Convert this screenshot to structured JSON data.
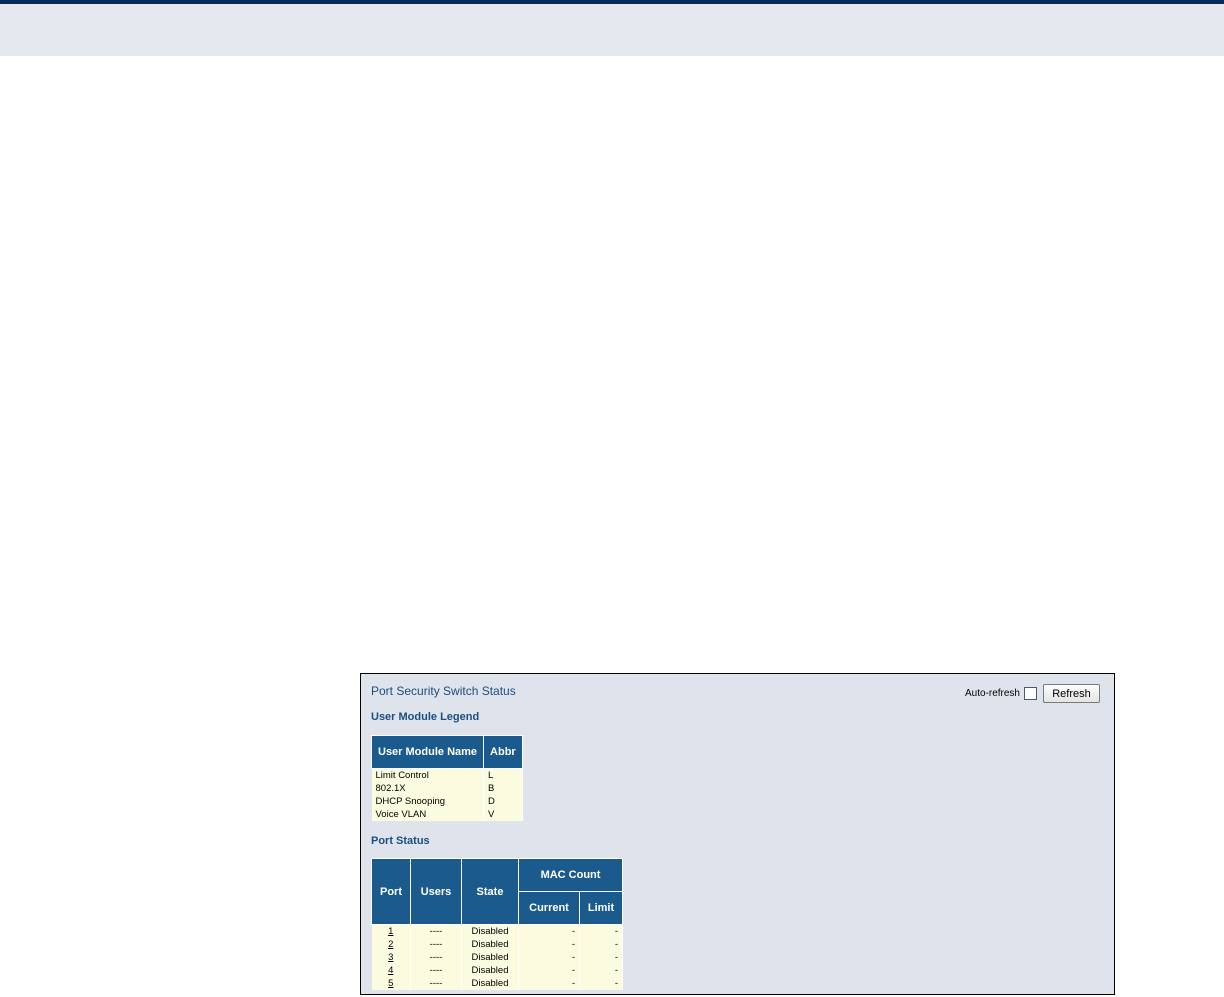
{
  "panel": {
    "title": "Port Security Switch Status",
    "auto_refresh_label": "Auto-refresh",
    "refresh_label": "Refresh"
  },
  "legend": {
    "heading": "User Module Legend",
    "headers": {
      "name": "User Module Name",
      "abbr": "Abbr"
    },
    "rows": [
      {
        "name": "Limit Control",
        "abbr": "L"
      },
      {
        "name": "802.1X",
        "abbr": "B"
      },
      {
        "name": "DHCP Snooping",
        "abbr": "D"
      },
      {
        "name": "Voice VLAN",
        "abbr": "V"
      }
    ]
  },
  "port_status": {
    "heading": "Port Status",
    "headers": {
      "port": "Port",
      "users": "Users",
      "state": "State",
      "mac_count": "MAC Count",
      "current": "Current",
      "limit": "Limit"
    },
    "rows": [
      {
        "port": "1",
        "users": "----",
        "state": "Disabled",
        "current": "-",
        "limit": "-"
      },
      {
        "port": "2",
        "users": "----",
        "state": "Disabled",
        "current": "-",
        "limit": "-"
      },
      {
        "port": "3",
        "users": "----",
        "state": "Disabled",
        "current": "-",
        "limit": "-"
      },
      {
        "port": "4",
        "users": "----",
        "state": "Disabled",
        "current": "-",
        "limit": "-"
      },
      {
        "port": "5",
        "users": "----",
        "state": "Disabled",
        "current": "-",
        "limit": "-"
      }
    ]
  }
}
